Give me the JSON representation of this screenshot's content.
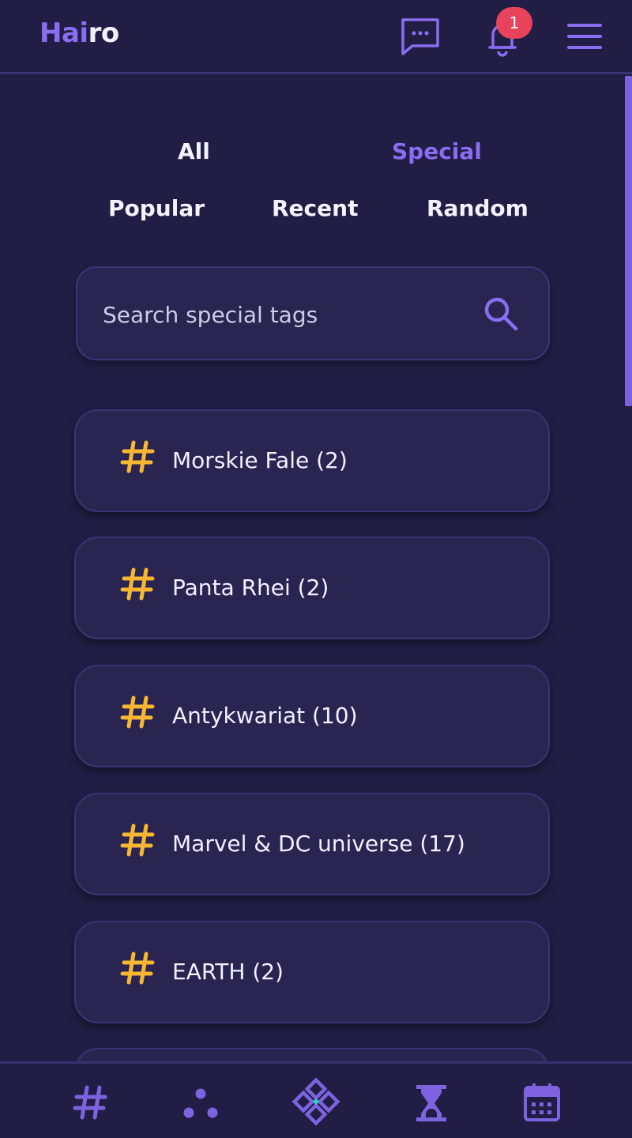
{
  "header": {
    "logo_part1": "Hai",
    "logo_part2": "ro",
    "notification_count": "1"
  },
  "tabs": [
    {
      "label": "All",
      "active": false
    },
    {
      "label": "Special",
      "active": true
    },
    {
      "label": "Popular",
      "active": false
    },
    {
      "label": "Recent",
      "active": false
    },
    {
      "label": "Random",
      "active": false
    }
  ],
  "search": {
    "placeholder": "Search special tags",
    "value": ""
  },
  "tags": [
    {
      "label": "Morskie Fale (2)"
    },
    {
      "label": "Panta Rhei (2)"
    },
    {
      "label": "Antykwariat (10)"
    },
    {
      "label": "Marvel & DC universe (17)"
    },
    {
      "label": "EARTH (2)"
    }
  ],
  "colors": {
    "accent": "#8a6df0",
    "hash": "#f7b733",
    "badge": "#e9435c",
    "background": "#221d44",
    "card": "#2a2450"
  },
  "bottom_nav": [
    {
      "icon": "hashtag-icon"
    },
    {
      "icon": "dots-icon"
    },
    {
      "icon": "diamond-grid-icon"
    },
    {
      "icon": "hourglass-icon"
    },
    {
      "icon": "calendar-icon"
    }
  ]
}
